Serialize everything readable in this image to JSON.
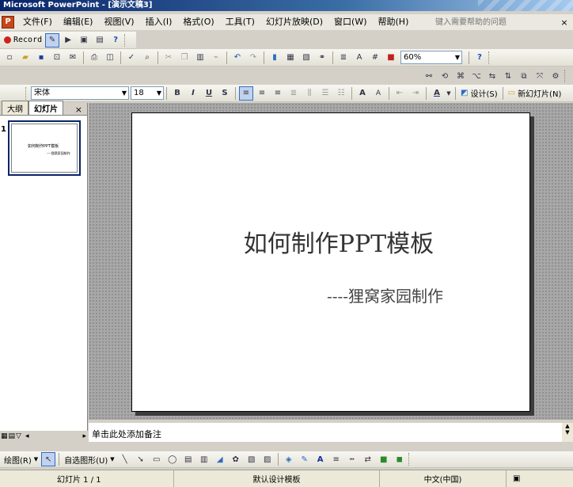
{
  "window": {
    "title": "Microsoft PowerPoint - [演示文稿3]"
  },
  "menu": {
    "items": [
      "文件(F)",
      "编辑(E)",
      "视图(V)",
      "插入(I)",
      "格式(O)",
      "工具(T)",
      "幻灯片放映(D)",
      "窗口(W)",
      "帮助(H)"
    ],
    "help_placeholder": "键入需要帮助的问题",
    "close_symbol": "×"
  },
  "record_toolbar": {
    "record_label": "Record"
  },
  "standard_toolbar": {
    "zoom": "60%"
  },
  "format_toolbar": {
    "font": "宋体",
    "font_size": "18",
    "bold": "B",
    "italic": "I",
    "underline": "U",
    "shadow": "S",
    "design_label": "设计(S)",
    "new_slide_label": "新幻灯片(N)"
  },
  "pane": {
    "tab_outline": "大纲",
    "tab_slides": "幻灯片",
    "close_symbol": "×",
    "slide_number": "1",
    "thumb_title": "如何制作PPT模板",
    "thumb_subtitle": "----狸窝家园制作"
  },
  "slide": {
    "title": "如何制作PPT模板",
    "subtitle": "----狸窝家园制作"
  },
  "notes": {
    "placeholder": "单击此处添加备注"
  },
  "drawing_toolbar": {
    "draw_label": "绘图(R)",
    "autoshapes_label": "自选图形(U)"
  },
  "status": {
    "slide_info": "幻灯片 1 / 1",
    "design": "默认设计模板",
    "language": "中文(中国)"
  },
  "colors": {
    "title_bar": "#0a246a",
    "workspace": "#a8a8a8",
    "active_tab": "#ffffff"
  }
}
